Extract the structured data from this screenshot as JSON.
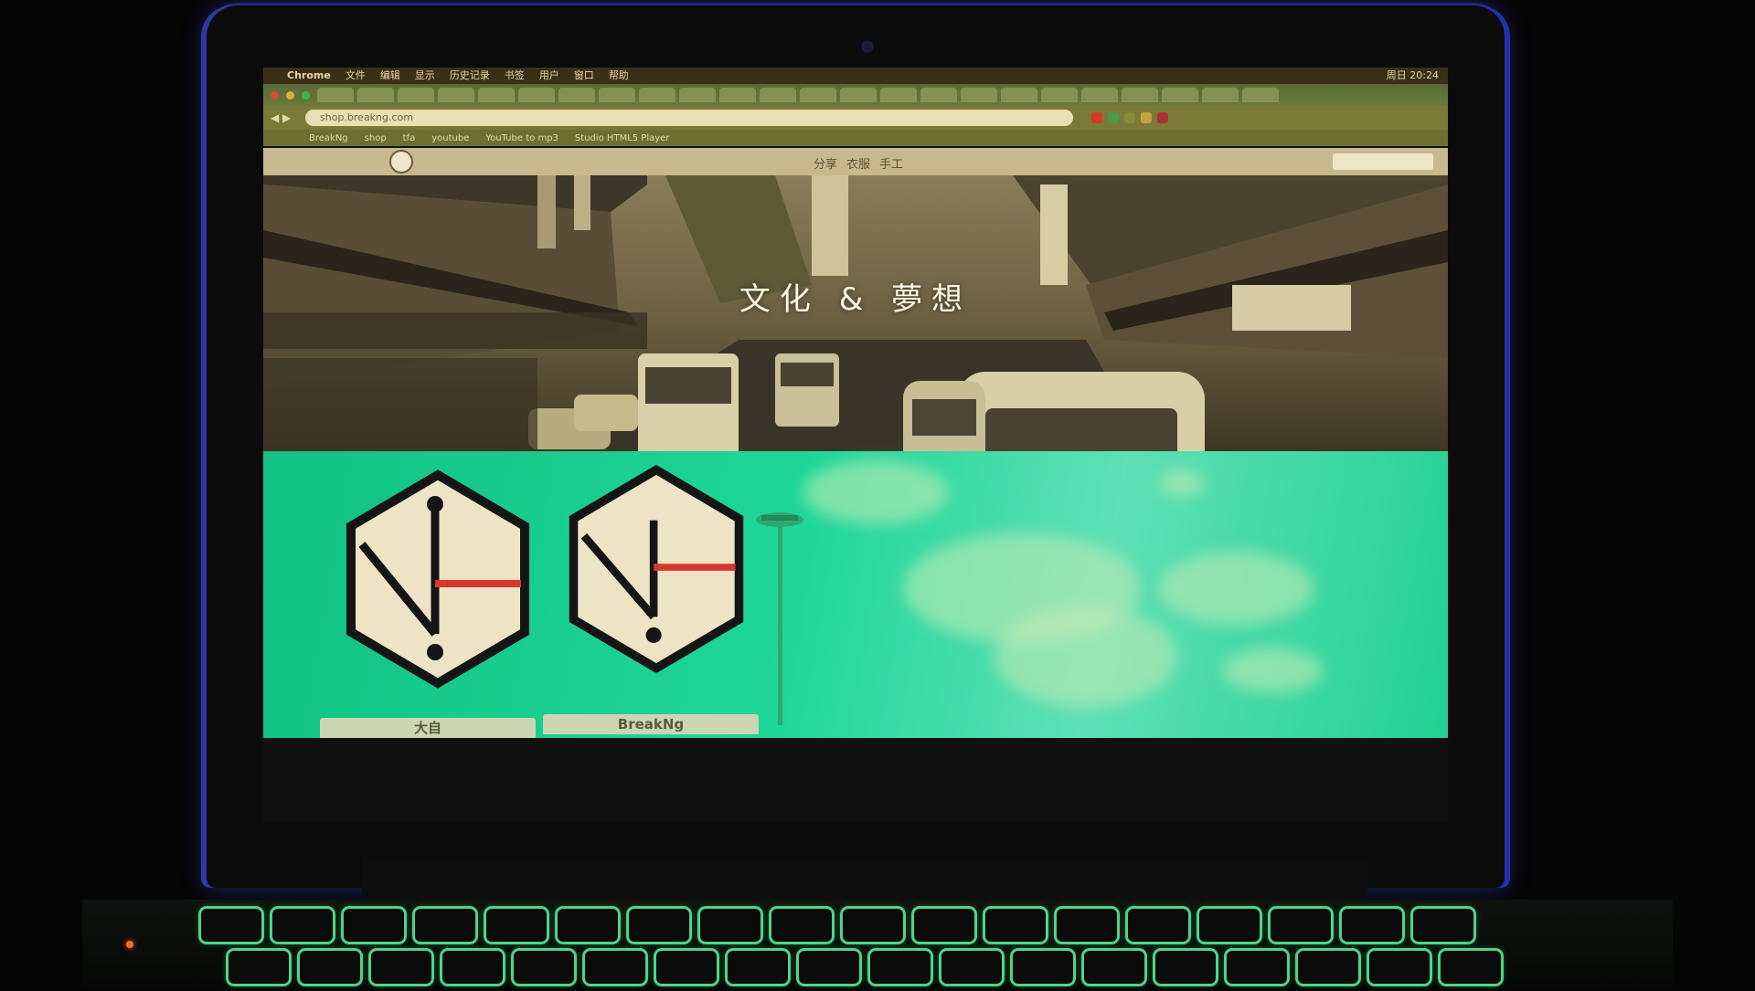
{
  "menubar": {
    "app": "Chrome",
    "items": [
      "文件",
      "编辑",
      "显示",
      "历史记录",
      "书签",
      "用户",
      "窗口",
      "帮助"
    ],
    "right_items": [
      "周日 20:24"
    ]
  },
  "browser": {
    "url": "shop.breakng.com",
    "bookmarks": [
      "BreakNg",
      "shop",
      "tfa",
      "youtube",
      "YouTube to mp3",
      "Studio HTML5 Player"
    ]
  },
  "site": {
    "nav_links": [
      "分享",
      "衣服",
      "手工"
    ],
    "hero_title": "文化 & 夢想"
  },
  "cards": [
    {
      "label": "大自"
    },
    {
      "label": "BreakNg"
    }
  ],
  "colors": {
    "screen_band": "#1ed799",
    "logo_red": "#d8382a",
    "logo_cream": "#efe3c6",
    "frame_blue": "#2c3aa8"
  },
  "icons": [
    "apple-icon",
    "site-logo-icon",
    "hexagon-logo-icon"
  ]
}
